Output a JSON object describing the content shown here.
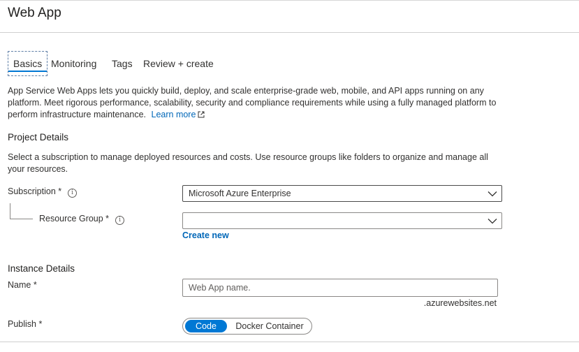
{
  "page": {
    "title": "Web App"
  },
  "tabs": [
    {
      "label": "Basics"
    },
    {
      "label": "Monitoring"
    },
    {
      "label": "Tags"
    },
    {
      "label": "Review + create"
    }
  ],
  "intro": {
    "text": "App Service Web Apps lets you quickly build, deploy, and scale enterprise-grade web, mobile, and API apps running on any platform. Meet rigorous performance, scalability, security and compliance requirements while using a fully managed platform to perform infrastructure maintenance.",
    "learn_more": "Learn more"
  },
  "project_details": {
    "title": "Project Details",
    "description": "Select a subscription to manage deployed resources and costs. Use resource groups like folders to organize and manage all your resources.",
    "subscription_label": "Subscription *",
    "subscription_value": "Microsoft Azure Enterprise",
    "resource_group_label": "Resource Group *",
    "resource_group_value": "",
    "create_new": "Create new"
  },
  "instance_details": {
    "title": "Instance Details",
    "name_label": "Name *",
    "name_placeholder": "Web App name.",
    "name_suffix": ".azurewebsites.net",
    "publish_label": "Publish *",
    "publish_options": [
      "Code",
      "Docker Container"
    ],
    "publish_selected": "Code"
  },
  "icons": {
    "info": "info-icon",
    "external_link": "external-link-icon",
    "dropdown": "chevron-down-icon"
  },
  "colors": {
    "accent": "#0078d4",
    "link": "#0067b8"
  }
}
